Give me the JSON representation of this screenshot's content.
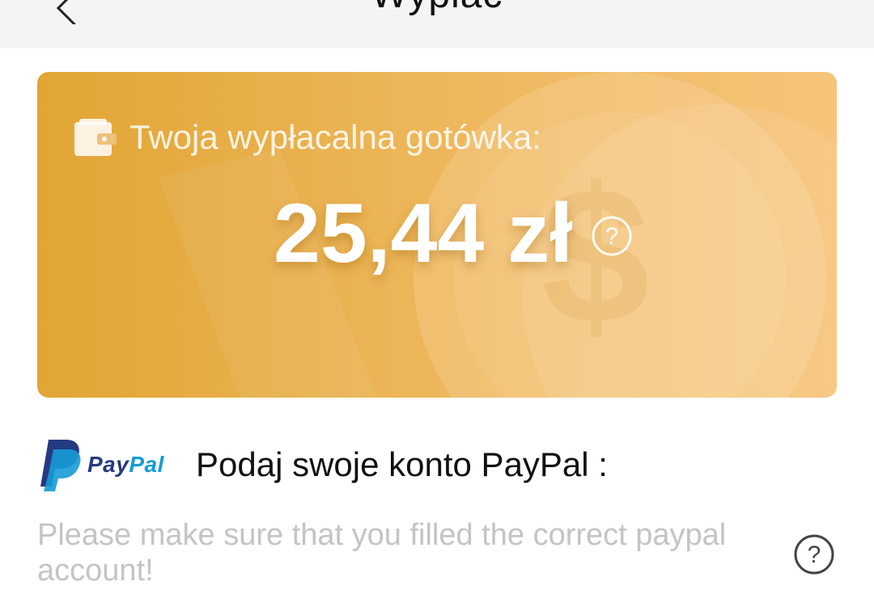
{
  "header": {
    "title": "Wypłać",
    "back_icon": "chevron-left-icon"
  },
  "balance_card": {
    "label": "Twoja wypłacalna gotówka:",
    "amount": "25,44 zł",
    "wallet_icon": "wallet-icon",
    "help_icon": "question-circle-icon",
    "colors": {
      "gradient_start": "#e1a534",
      "gradient_end": "#f6c47a"
    }
  },
  "paypal_section": {
    "logo_text_pay": "Pay",
    "logo_text_pal": "Pal",
    "heading": "Podaj swoje konto PayPal :",
    "input_value": "",
    "input_placeholder": "Please make sure that you filled the correct paypal account!",
    "help_icon": "question-circle-icon",
    "colors": {
      "paypal_dark": "#253b80",
      "paypal_light": "#179bd7"
    }
  }
}
